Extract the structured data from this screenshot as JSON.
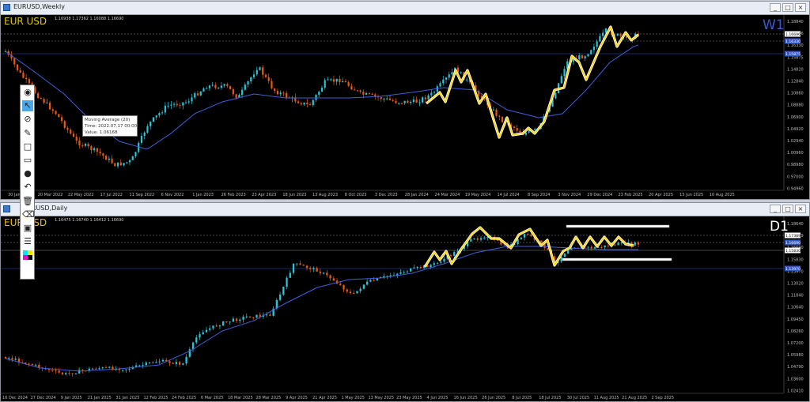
{
  "window_top": {
    "title": "EURUSD,Weekly",
    "symbol_label": "EUR USD",
    "timeframe_label": "W1",
    "ohlc": "1.16938 1.17362 1.16088 1.16690",
    "price_labels": [
      "1.18840",
      "1.16696",
      "1.16330",
      "1.15875",
      "1.14820",
      "1.12840",
      "1.10860",
      "1.08880",
      "1.06900",
      "1.04920",
      "1.02940",
      "1.00960",
      "0.98980",
      "0.97000",
      "0.94960"
    ],
    "date_labels": [
      "30 Jan 2022",
      "20 Mar 2022",
      "22 May 2022",
      "17 Jul 2022",
      "11 Sep 2022",
      "6 Nov 2022",
      "1 Jan 2023",
      "26 Feb 2023",
      "23 Apr 2023",
      "18 Jun 2023",
      "13 Aug 2023",
      "8 Oct 2023",
      "3 Dec 2023",
      "28 Jan 2024",
      "24 Mar 2024",
      "19 May 2024",
      "14 Jul 2024",
      "8 Sep 2024",
      "3 Nov 2024",
      "29 Dec 2024",
      "23 Feb 2025",
      "20 Apr 2025",
      "15 Jun 2025",
      "10 Aug 2025"
    ],
    "buttons": {
      "minimize": "_",
      "maximize": "□",
      "close": "×"
    }
  },
  "window_bottom": {
    "title": "EURUSD,Daily",
    "symbol_label": "EUR USD",
    "timeframe_label": "D1",
    "ohlc": "1.16475 1.16740 1.16412 1.16690",
    "price_labels": [
      "1.18640",
      "1.17389",
      "1.16690",
      "1.15830",
      "1.13970",
      "1.13020",
      "1.11840",
      "1.10640",
      "1.09450",
      "1.08260",
      "1.07200",
      "1.05980",
      "1.04790",
      "1.03600",
      "1.02410"
    ],
    "date_labels": [
      "16 Dec 2024",
      "27 Dec 2024",
      "9 Jan 2025",
      "21 Jan 2025",
      "31 Jan 2025",
      "12 Feb 2025",
      "24 Feb 2025",
      "6 Mar 2025",
      "18 Mar 2025",
      "28 Mar 2025",
      "9 Apr 2025",
      "21 Apr 2025",
      "1 May 2025",
      "13 May 2025",
      "23 May 2025",
      "4 Jun 2025",
      "16 Jun 2025",
      "26 Jun 2025",
      "8 Jul 2025",
      "18 Jul 2025",
      "30 Jul 2025",
      "11 Aug 2025",
      "21 Aug 2025",
      "2 Sep 2025"
    ],
    "buttons": {
      "minimize": "_",
      "maximize": "□",
      "close": "×"
    }
  },
  "tooltip": {
    "line1": "Moving Average (20)",
    "line2": "Time: 2022.07.17 00:00",
    "line3": "Value: 1.06168"
  },
  "toolbar_tools": [
    "pin-icon",
    "eye-icon",
    "cursor-icon",
    "hide-icon",
    "pencil-icon",
    "rectangle-icon",
    "eraser-icon",
    "dot-icon",
    "undo-icon",
    "trash-icon",
    "trash-all-icon",
    "screenshot-icon",
    "clipboard-icon",
    "color-palette-icon"
  ],
  "colors": {
    "bull": "#26c6da",
    "bear": "#e8590c",
    "ma": "#3f5fd8",
    "zigzag": "#ffd400",
    "symbol": "#e8c200",
    "tf_top": "#3a5ad0",
    "tf_bottom": "#ffffff"
  }
}
